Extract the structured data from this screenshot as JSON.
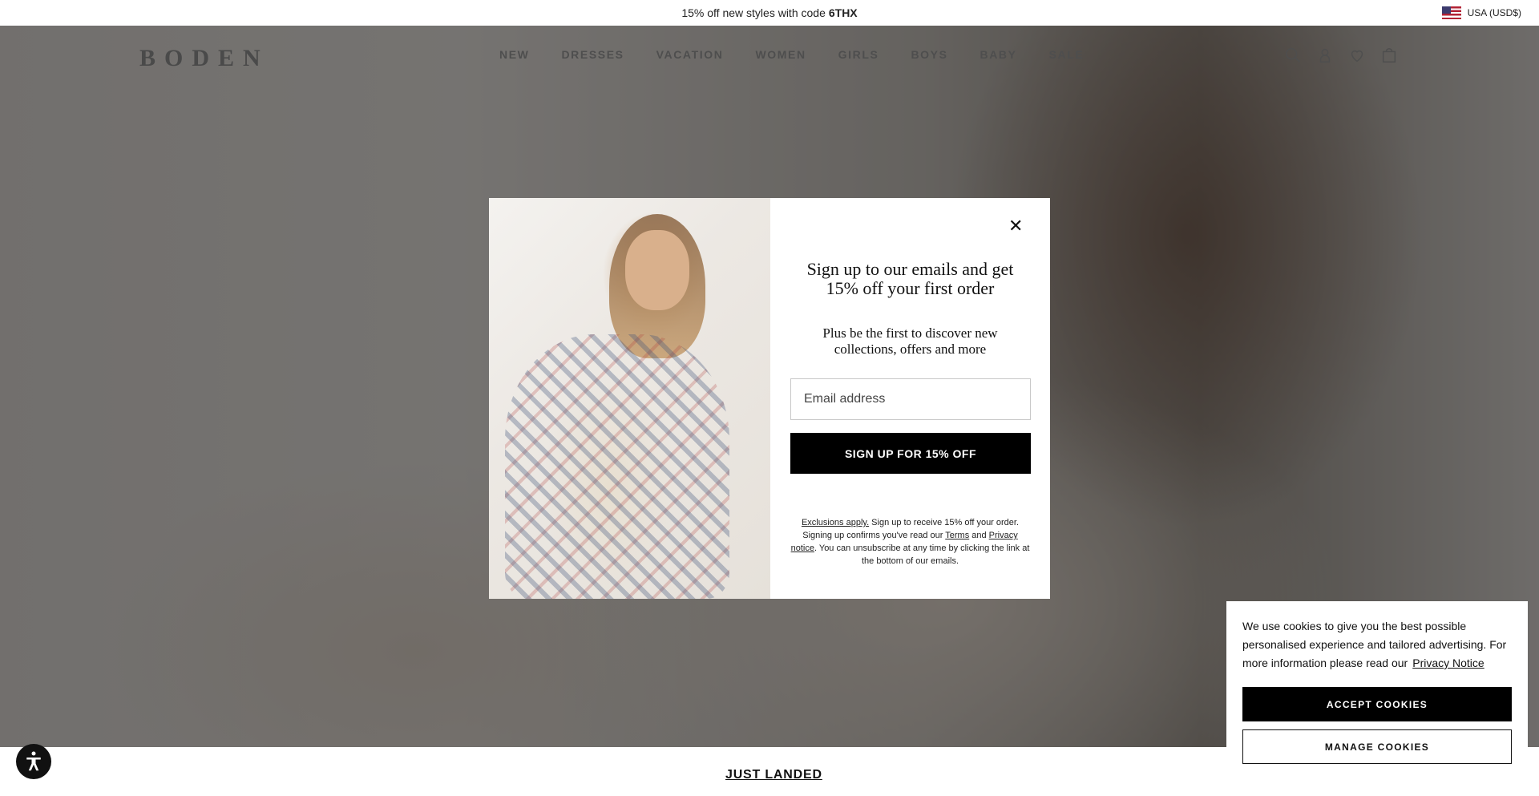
{
  "promo": {
    "text": "15% off new styles with code",
    "code": "6THX"
  },
  "locale": {
    "label": "USA (USD$)",
    "flag_icon": "usa-flag-icon"
  },
  "header": {
    "logo": "BODEN",
    "nav": [
      "NEW",
      "DRESSES",
      "VACATION",
      "WOMEN",
      "GIRLS",
      "BOYS",
      "BABY",
      "SALE"
    ],
    "icons": [
      "search-icon",
      "account-icon",
      "wishlist-heart-icon",
      "bag-icon"
    ]
  },
  "modal": {
    "close_icon": "close-icon",
    "title": "Sign up to our emails and get 15% off your first order",
    "subtitle": "Plus be the first to discover new collections, offers and more",
    "email_placeholder": "Email address",
    "signup_label": "SIGN UP FOR 15% OFF",
    "fineprint": {
      "exclusions_link": "Exclusions apply.",
      "text1": " Sign up to receive 15% off your order. Signing up confirms you've read our ",
      "terms_link": "Terms",
      "text2": " and ",
      "privacy_link": "Privacy notice",
      "text3": ". You can unsubscribe at any time by clicking the link at the bottom of our emails."
    }
  },
  "page": {
    "just_landed": "JUST LANDED",
    "accessibility_icon": "accessibility-icon"
  },
  "cookie": {
    "text": "We use cookies to give you the best possible personalised experience and tailored advertising. For more information please read our",
    "privacy_link": "Privacy Notice",
    "accept_label": "ACCEPT COOKIES",
    "manage_label": "MANAGE COOKIES"
  }
}
